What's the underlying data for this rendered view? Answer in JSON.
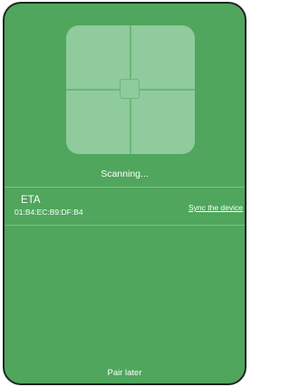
{
  "scan": {
    "status": "Scanning..."
  },
  "device": {
    "name": "ETA",
    "mac": "01:B4:EC:B9:DF:B4",
    "sync_label": "Sync the device"
  },
  "footer": {
    "pair_later_label": "Pair later"
  },
  "colors": {
    "background": "#4fa65c",
    "scan_frame": "#8fcb9c",
    "text": "#ffffff"
  }
}
